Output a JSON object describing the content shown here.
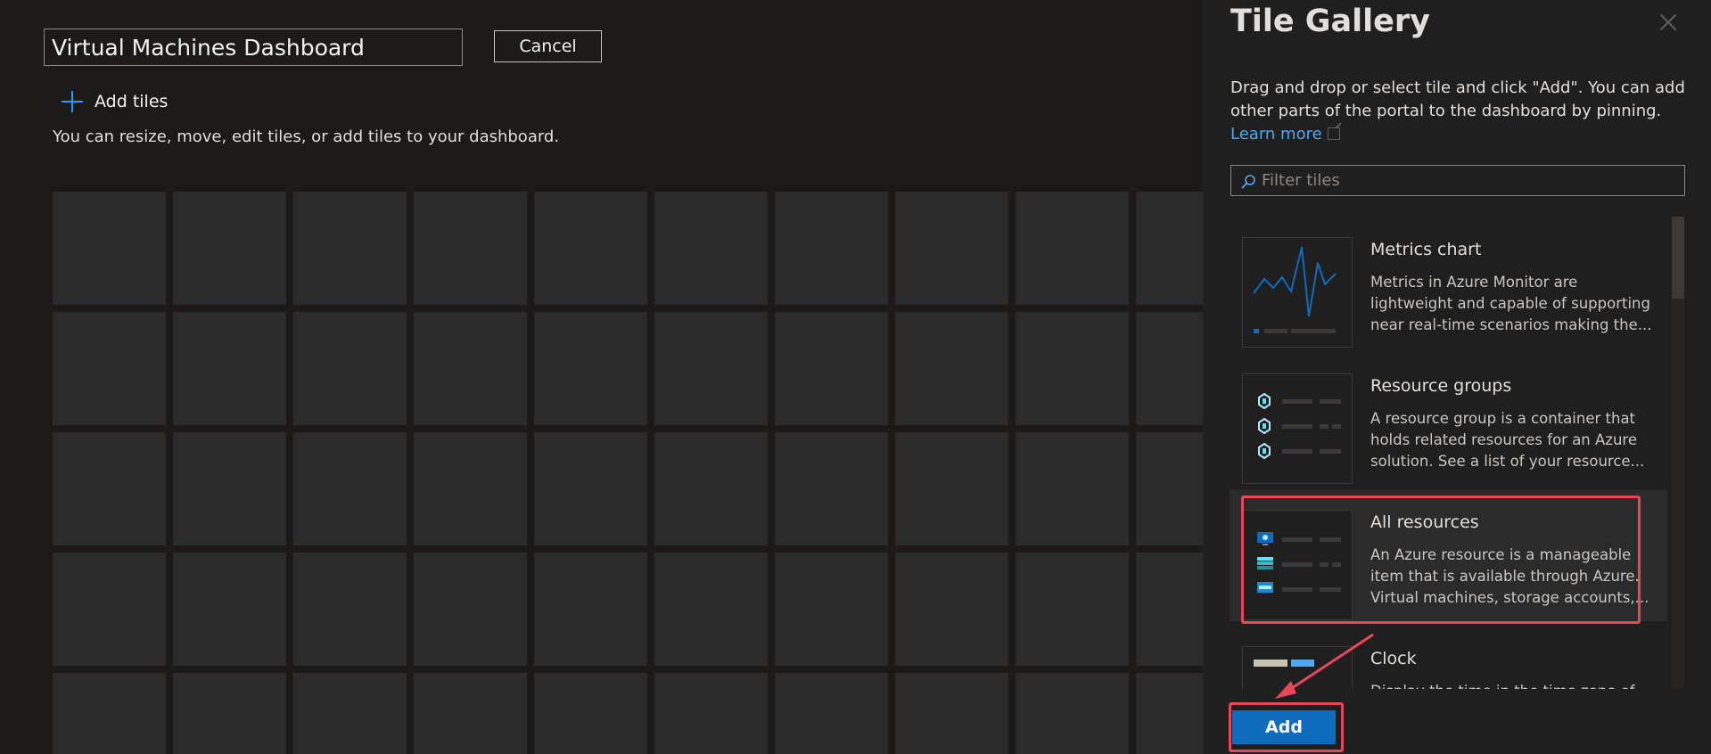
{
  "editor": {
    "dashboard_title": "Virtual Machines Dashboard",
    "cancel_label": "Cancel",
    "add_tiles_label": "Add tiles",
    "hint": "You can resize, move, edit tiles, or add tiles to your dashboard."
  },
  "panel": {
    "title": "Tile Gallery",
    "description": "Drag and drop or select tile and click \"Add\". You can add other parts of the portal to the dashboard by pinning.",
    "learn_more": "Learn more",
    "filter_placeholder": "Filter tiles",
    "tiles": [
      {
        "name": "Metrics chart",
        "description": "Metrics in Azure Monitor are lightweight and capable of supporting near real-time scenarios making the..."
      },
      {
        "name": "Resource groups",
        "description": "A resource group is a container that holds related resources for an Azure solution. See a list of your resource..."
      },
      {
        "name": "All resources",
        "description": "An Azure resource is a manageable item that is available through Azure. Virtual machines, storage accounts,..."
      },
      {
        "name": "Clock",
        "description": "Display the time in the time zone of..."
      }
    ],
    "add_label": "Add"
  },
  "colors": {
    "accent": "#0f6cbd",
    "link": "#4fa8f0",
    "highlight": "#e74856"
  }
}
